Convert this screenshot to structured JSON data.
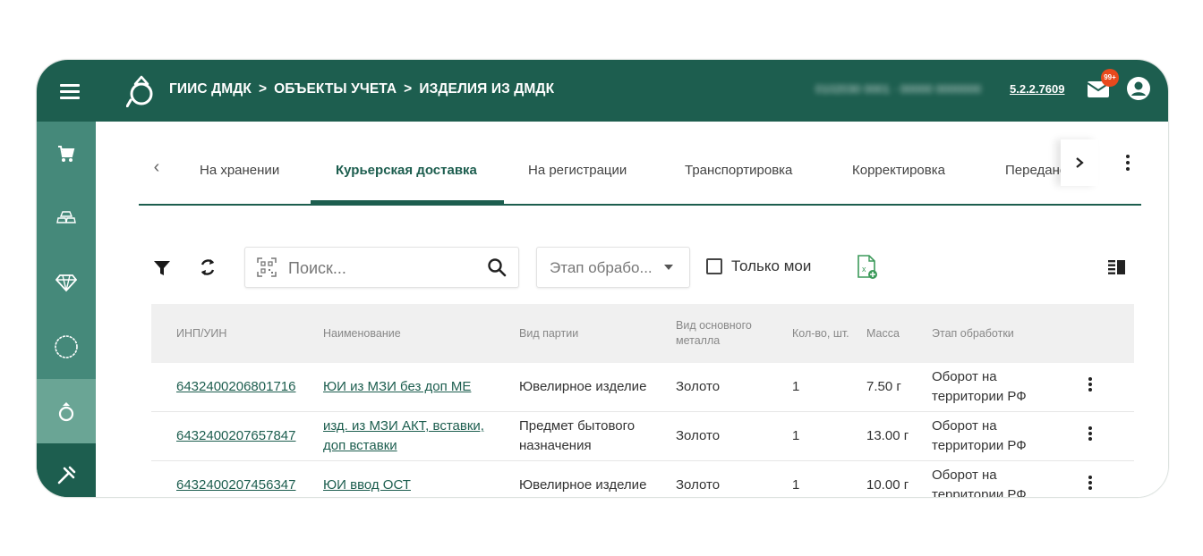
{
  "header": {
    "breadcrumb": [
      "ГИИС ДМДК",
      ">",
      "ОБЪЕКТЫ УЧЕТА",
      ">",
      "ИЗДЕЛИЯ ИЗ ДМДК"
    ],
    "user_info": "0102030 0001 · 00000 0000000",
    "version": "5.2.2.7609",
    "notifications_badge": "99+",
    "menu_icon": "hamburger-icon",
    "logo_icon": "ring-logo-icon",
    "mail_icon": "mail-icon",
    "user_icon": "account-circle-icon",
    "brand_color": "#1d5e4f"
  },
  "sidebar": {
    "items": [
      {
        "icon": "cart-icon",
        "active": false
      },
      {
        "icon": "ingots-icon",
        "active": false
      },
      {
        "icon": "diamond-icon",
        "active": false
      },
      {
        "icon": "circle-icon",
        "active": false
      },
      {
        "icon": "ring-icon",
        "active": true
      },
      {
        "icon": "tools-icon",
        "active": false
      }
    ]
  },
  "tabs": {
    "items": [
      {
        "label": "На хранении",
        "active": false
      },
      {
        "label": "Курьерская доставка",
        "active": true
      },
      {
        "label": "На регистрации",
        "active": false
      },
      {
        "label": "Транспортировка",
        "active": false
      },
      {
        "label": "Корректировка",
        "active": false
      },
      {
        "label": "Передано",
        "active": false
      }
    ]
  },
  "toolbar": {
    "search_placeholder": "Поиск...",
    "stage_select_value": "Этап обрабо...",
    "only_mine_label": "Только мои",
    "only_mine_checked": false
  },
  "table": {
    "columns": [
      "ИНП/УИН",
      "Наименование",
      "Вид партии",
      "Вид основного металла",
      "Кол-во, шт.",
      "Масса",
      "Этап обработки"
    ],
    "rows": [
      {
        "uin": "6432400206801716",
        "name": "ЮИ из МЗИ без доп МЕ",
        "batch_type": "Ювелирное изделие",
        "metal": "Золото",
        "qty": "1",
        "mass": "7.50 г",
        "stage": "Оборот на территории РФ"
      },
      {
        "uin": "6432400207657847",
        "name": "изд. из МЗИ АКТ, вставки, доп вставки",
        "batch_type": "Предмет бытового назначения",
        "metal": "Золото",
        "qty": "1",
        "mass": "13.00 г",
        "stage": "Оборот на территории РФ"
      },
      {
        "uin": "6432400207456347",
        "name": "ЮИ ввод ОСТ",
        "batch_type": "Ювелирное изделие",
        "metal": "Золото",
        "qty": "1",
        "mass": "10.00 г",
        "stage": "Оборот на территории РФ"
      }
    ]
  }
}
